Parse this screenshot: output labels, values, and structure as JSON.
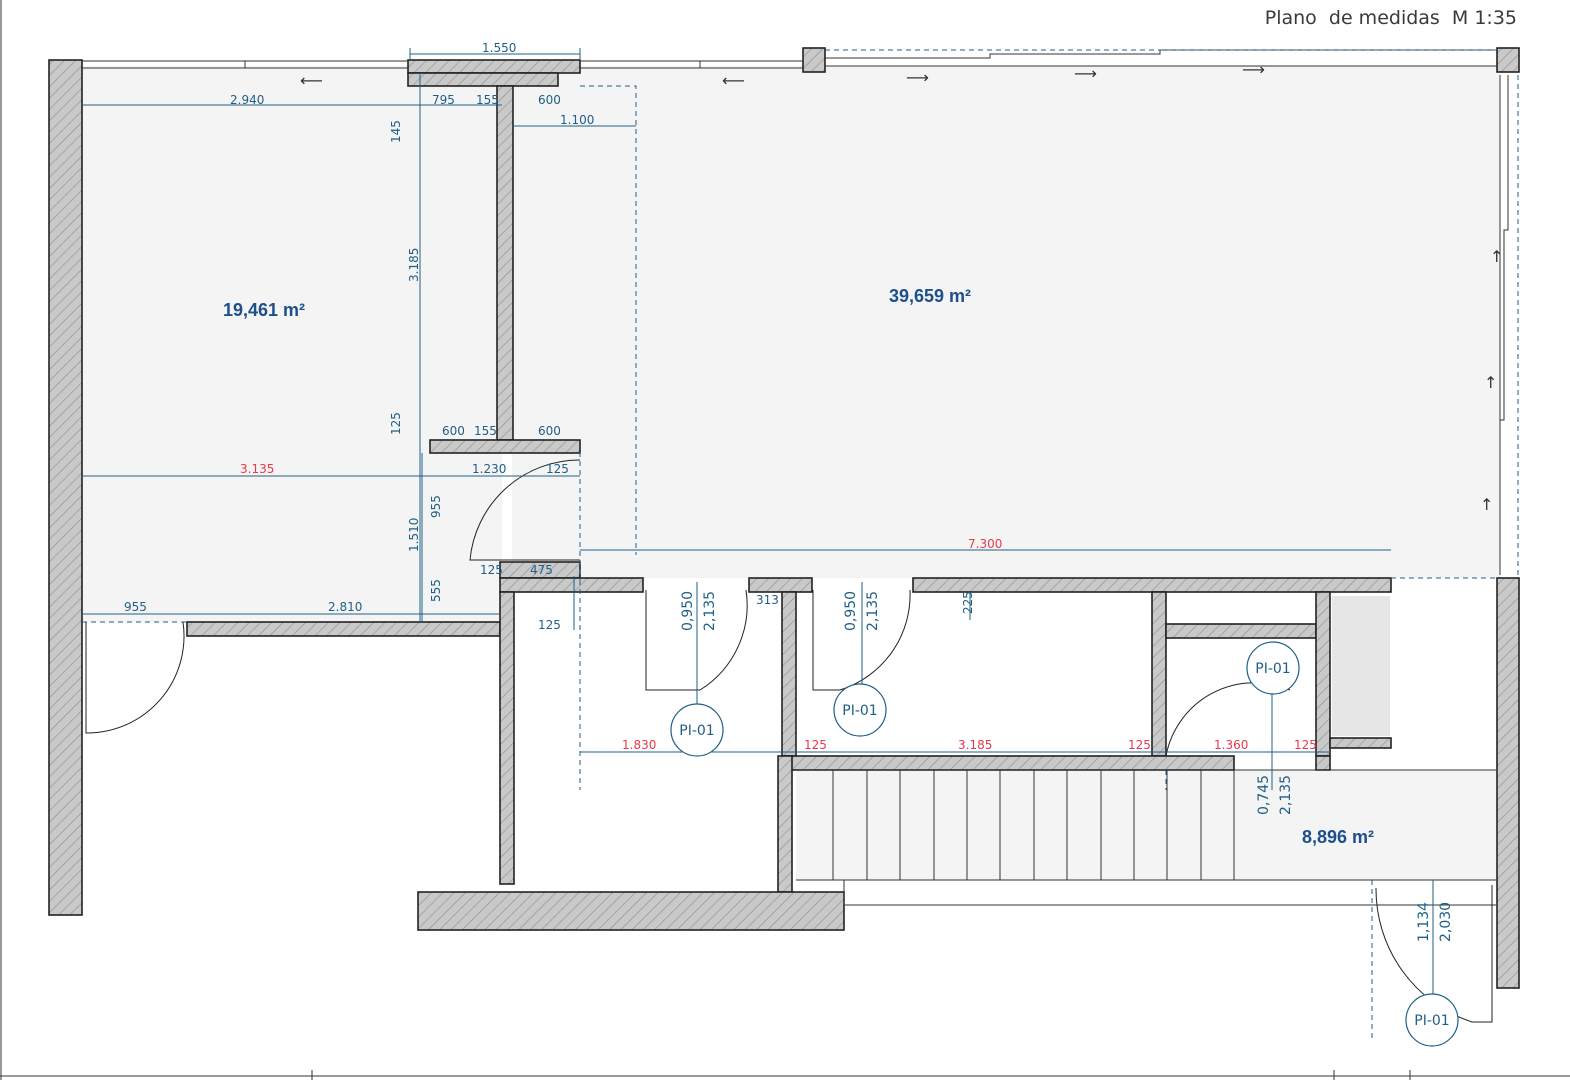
{
  "sheet": {
    "title": "Plano  de medidas  M 1:35"
  },
  "areas": {
    "left_room": "19,461 m²",
    "main_room": "39,659 m²",
    "stair_room": "8,896 m²"
  },
  "door_tags": {
    "tag1": "PI-01",
    "tag2": "PI-01",
    "tag3": "PI-01",
    "tag4": "PI-01"
  },
  "door_heights": {
    "d1_a": "0,950",
    "d1_b": "2,135",
    "d2_a": "0,950",
    "d2_b": "2,135",
    "d3_a": "0,745",
    "d3_b": "2,135",
    "d4_a": "1,134",
    "d4_b": "2,030"
  },
  "dims": {
    "top_1550": "1.550",
    "d2940": "2.940",
    "d795": "795",
    "d155a": "155",
    "d600a": "600",
    "d1100": "1.100",
    "d145": "145",
    "d3185v": "3.185",
    "d125v": "125",
    "d600b": "600",
    "d155b": "155",
    "d600c": "600",
    "d3135": "3.135",
    "d1230": "1.230",
    "d125a": "125",
    "d955v": "955",
    "d1510": "1.510",
    "d125b": "125",
    "d475": "475",
    "d555": "555",
    "d955": "955",
    "d2810": "2.810",
    "d125c": "125",
    "d7300": "7.300",
    "d313": "313",
    "d225": "225",
    "d1830": "1.830",
    "d125d": "125",
    "d3185h": "3.185",
    "d125e": "125",
    "d1360": "1.360",
    "d125f": "125"
  }
}
